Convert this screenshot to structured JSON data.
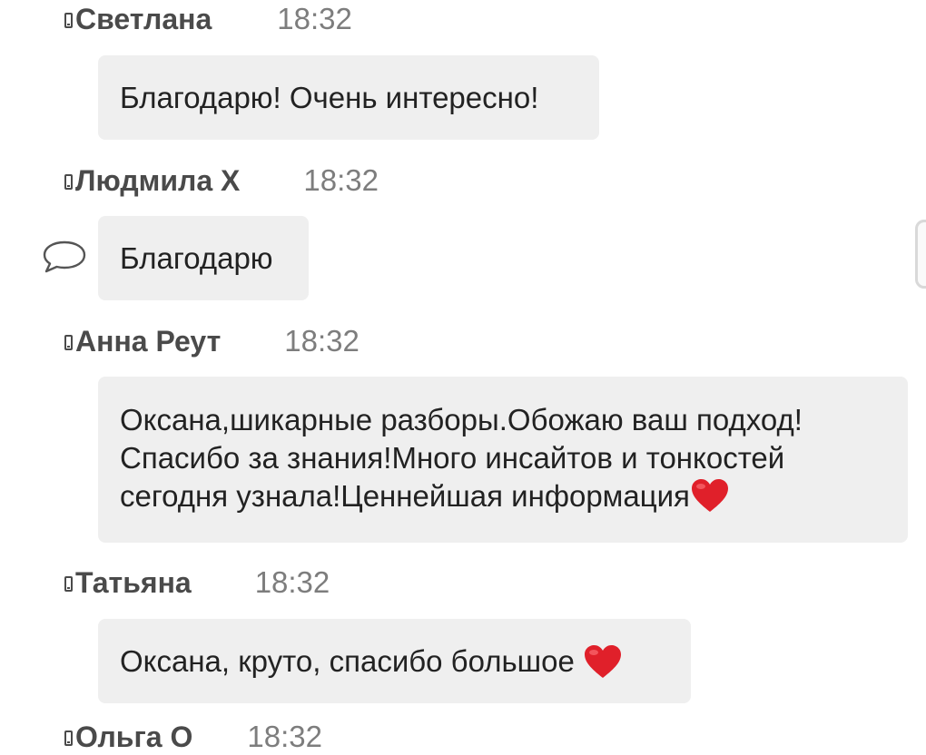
{
  "messages": [
    {
      "author": "Светлана",
      "time": "18:32",
      "text": "Благодарю! Очень интересно!"
    },
    {
      "author": "Людмила Х",
      "time": "18:32",
      "text": "Благодарю"
    },
    {
      "author": "Анна Реут",
      "time": "18:32",
      "lines": [
        "Оксана,шикарные разборы.Обожаю ваш подход!",
        "Спасибо за знания!Много инсайтов и тонкостей",
        "сегодня узнала!Ценнейшая информация"
      ]
    },
    {
      "author": "Татьяна",
      "time": "18:32",
      "text": "Оксана, круто, спасибо большое "
    },
    {
      "author": "Ольга О",
      "time": "18:32"
    }
  ],
  "icons": {
    "author_prefix": "phone-icon",
    "reply": "speech-bubble-icon",
    "emoji": "red-heart-icon"
  },
  "colors": {
    "bubble": "#efefef",
    "author": "#4a4a4a",
    "time": "#7d7d7d",
    "heart": "#e0202a"
  }
}
